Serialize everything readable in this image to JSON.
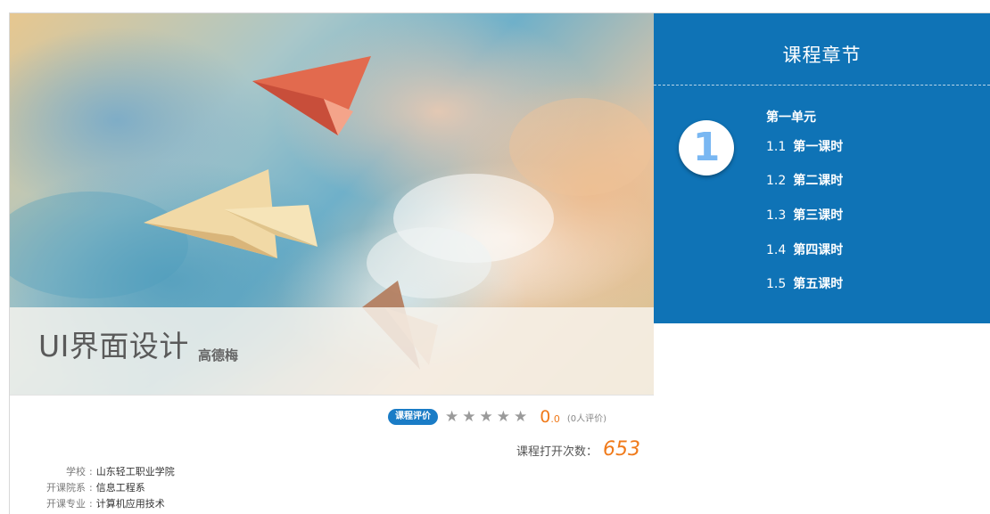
{
  "course": {
    "title": "UI界面设计",
    "teacher": "高德梅"
  },
  "chapters": {
    "heading": "课程章节",
    "unit_number": "1",
    "unit_name": "第一单元",
    "lessons": [
      {
        "num": "1.1",
        "name": "第一课时"
      },
      {
        "num": "1.2",
        "name": "第二课时"
      },
      {
        "num": "1.3",
        "name": "第三课时"
      },
      {
        "num": "1.4",
        "name": "第四课时"
      },
      {
        "num": "1.5",
        "name": "第五课时"
      }
    ]
  },
  "rating": {
    "badge": "课程评价",
    "stars_filled": 0,
    "stars_total": 5,
    "score_int": "0",
    "score_dec": ".0",
    "count_text": "(0人评价)"
  },
  "opens": {
    "label": "课程打开次数：",
    "value": "653"
  },
  "info": {
    "school_label": "学校",
    "school": "山东轻工职业学院",
    "department_label": "开课院系",
    "department": "信息工程系",
    "major_label": "开课专业",
    "major": "计算机应用技术"
  },
  "colors": {
    "panel": "#0f73b6",
    "accent": "#f07a1a",
    "badge": "#1a7cc6"
  },
  "icons": {
    "star": "star-icon"
  }
}
